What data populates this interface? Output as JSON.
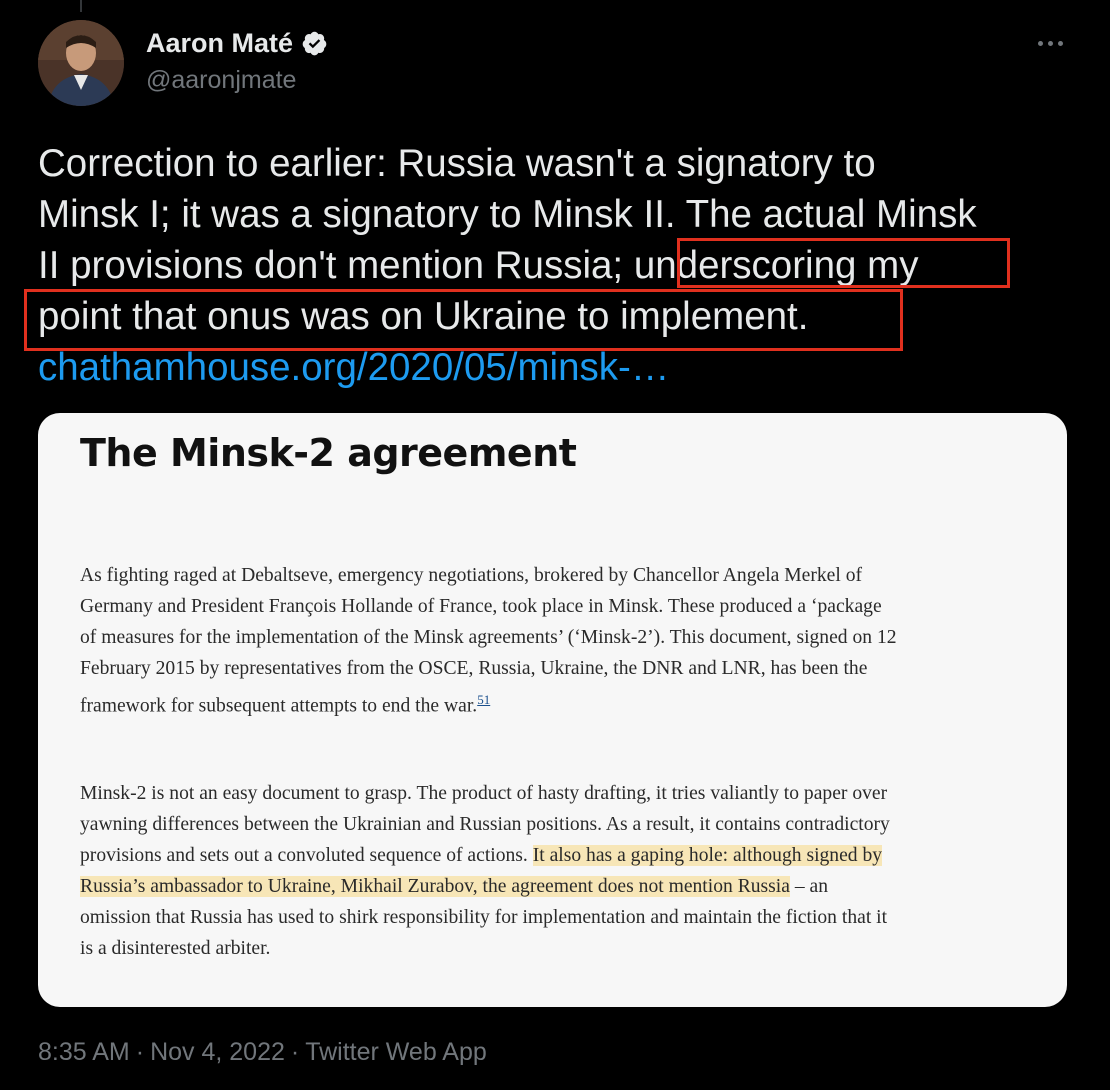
{
  "author": {
    "display_name": "Aaron Maté",
    "handle": "@aaronjmate",
    "verified_icon": "verified-badge-icon"
  },
  "tweet": {
    "line1": "Correction to earlier: Russia wasn't a signatory to",
    "line2": "Minsk I; it was a signatory to Minsk II. The actual Minsk",
    "line3_a": "II provisions don't mention Russia; ",
    "line3_b": "underscoring my",
    "line4": "point that onus was on Ukraine to implement.",
    "link": "chathamhouse.org/2020/05/minsk-…"
  },
  "card": {
    "heading": "The Minsk-2 agreement",
    "para1": "As fighting raged at Debaltseve, emergency negotiations, brokered by Chancellor Angela Merkel of Germany and President François Hollande of France, took place in Minsk. These produced a ‘package of measures for the implementation of the Minsk agreements’ (‘Minsk-2’). This document, signed on 12 February 2015 by representatives from the OSCE, Russia, Ukraine, the DNR and LNR, has been the framework for subsequent attempts to end the war.",
    "para1_footnote": "51",
    "para2_a": "Minsk-2 is not an easy document to grasp. The product of hasty drafting, it tries valiantly to paper over yawning differences between the Ukrainian and Russian positions. As a result, it contains contradictory provisions and sets out a convoluted sequence of actions. ",
    "para2_highlight": "It also has a gaping hole: although signed by Russia’s ambassador to Ukraine, Mikhail Zurabov, the agreement does not mention Russia",
    "para2_b": " – an omission that Russia has used to shirk responsibility for implementation and maintain the fiction that it is a disinterested arbiter."
  },
  "meta": {
    "time": "8:35 AM",
    "date": "Nov 4, 2022",
    "source": "Twitter Web App",
    "separator": "·"
  },
  "colors": {
    "background": "#000000",
    "link": "#1d9bf0",
    "annotation_box": "#e0301e",
    "highlight": "#f7e6b7"
  }
}
